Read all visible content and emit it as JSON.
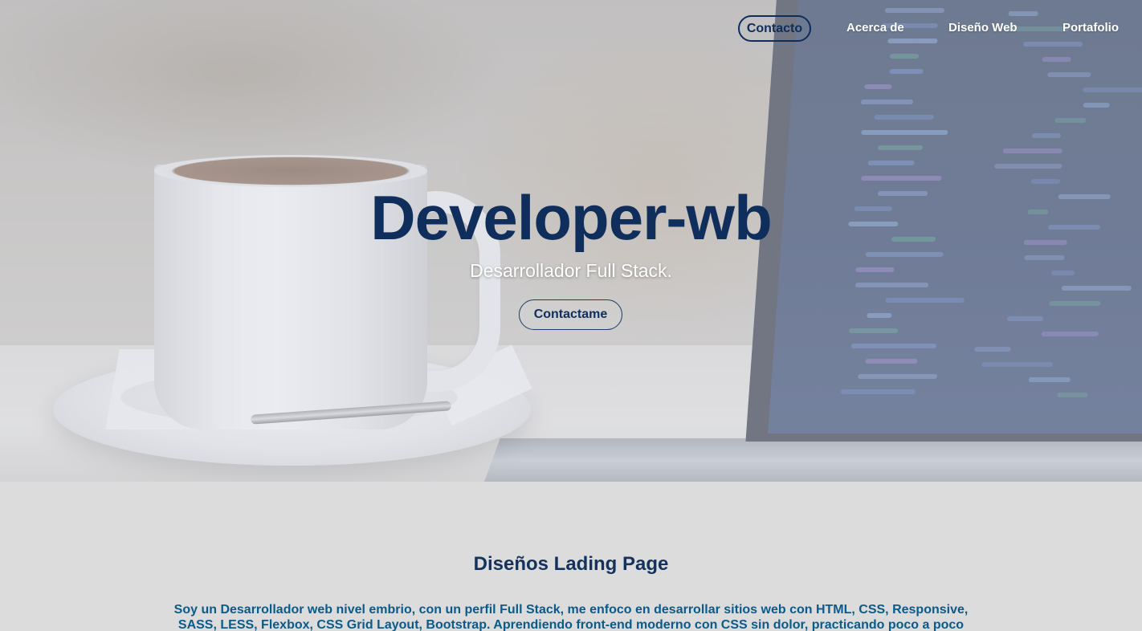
{
  "nav": {
    "items": [
      {
        "label": "Contacto"
      },
      {
        "label": "Acerca de"
      },
      {
        "label": "Diseño Web"
      },
      {
        "label": "Portafolio"
      }
    ]
  },
  "hero": {
    "title": "Developer-wb",
    "subtitle": "Desarrollador Full Stack.",
    "button_label": "Contactame"
  },
  "section": {
    "title": "Diseños Lading Page",
    "text": "Soy un Desarrollador web nivel embrio, con un perfil Full Stack, me enfoco en desarrollar sitios web con HTML, CSS, Responsive, SASS, LESS, Flexbox, CSS Grid Layout, Bootstrap. Aprendiendo front-end moderno con CSS sin dolor, practicando poco a poco con las tecnologías más"
  },
  "colors": {
    "primary": "#0f2e5c",
    "section_bg": "#dcdcdc",
    "section_text": "#0a5a8a"
  }
}
